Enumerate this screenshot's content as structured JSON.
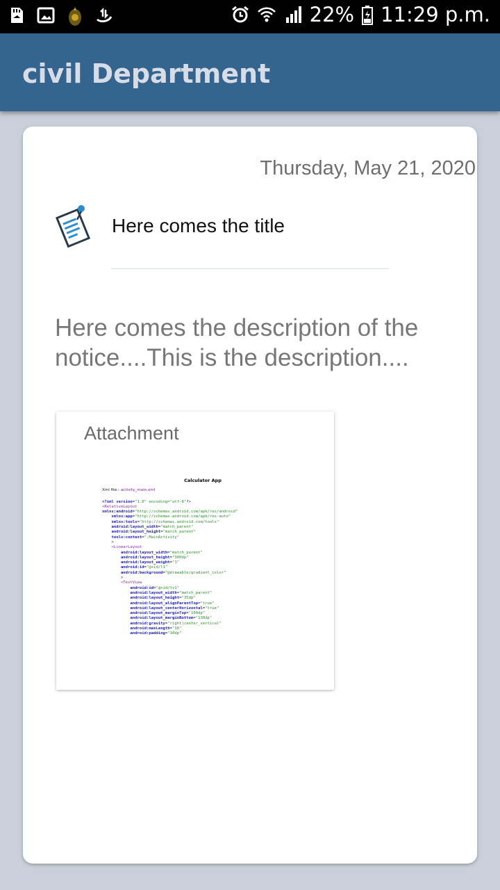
{
  "status_bar": {
    "battery": "22%",
    "time": "11:29 p.m.",
    "icons": [
      "sd-card-icon",
      "image-icon",
      "app-logo-icon",
      "usb-transfer-icon",
      "alarm-icon",
      "wifi-icon",
      "signal-icon",
      "battery-icon"
    ]
  },
  "app_bar": {
    "title": "civil Department"
  },
  "notice": {
    "date": "Thursday, May 21, 2020",
    "title": "Here comes the title",
    "description": "Here comes the description of the notice....This is the description....",
    "attachment_label": "Attachment",
    "attachment_doc": {
      "heading": "Calculator App",
      "file_label": "Xml file:-",
      "file_name": "activity_main.xml",
      "lines": [
        "<?xml version=\"1.0\" encoding=\"utf-8\"?>",
        "<RelativeLayout",
        "xmlns:android=\"http://schemas.android.com/apk/res/android\"",
        "    xmlns:app=\"http://schemas.android.com/apk/res-auto\"",
        "    xmlns:tools=\"http://schemas.android.com/tools\"",
        "    android:layout_width=\"match_parent\"",
        "    android:layout_height=\"match_parent\"",
        "    tools:context=\".MainActivity\"",
        "    >",
        "    <LinearLayout",
        "        android:layout_width=\"match_parent\"",
        "        android:layout_height=\"300dp\"",
        "        android:layout_weight=\"1\"",
        "        android:id=\"@+id/l1\"",
        "        android:background=\"@drawable/gradient_color\"",
        "        >",
        "",
        "        <TextView",
        "            android:id=\"@+id/tv1\"",
        "            android:layout_width=\"match_parent\"",
        "            android:layout_height=\"35dp\"",
        "            android:layout_alignParentTop=\"true\"",
        "            android:layout_centerHorizontal=\"true\"",
        "            android:layout_marginTop=\"100dp\"",
        "            android:layout_marginBottom=\"130dp\"",
        "            android:gravity=\"right|center_vertical\"",
        "            android:maxLength=\"16\"",
        "            android:padding=\"10dp\""
      ]
    }
  }
}
